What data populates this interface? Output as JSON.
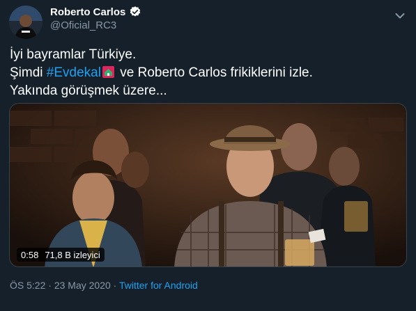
{
  "tweet": {
    "author_name": "Roberto Carlos",
    "author_handle": "@Oficial_RC3",
    "text_line1": "İyi bayramlar Türkiye.",
    "text_line2_prefix": "Şimdi ",
    "hashtag": "#Evdekal",
    "text_line2_suffix": " ve Roberto Carlos frikiklerini izle.",
    "text_line3": "Yakında görüşmek üzere..."
  },
  "video": {
    "duration": "0:58",
    "views": "71,8 B izleyici"
  },
  "meta": {
    "time": "ÖS 5:22",
    "separator": " · ",
    "date": "23 May 2020",
    "source": "Twitter for Android"
  },
  "colors": {
    "background": "#15202b",
    "link": "#1da1f2",
    "secondary_text": "#8899a6",
    "verified_badge": "#ffffff"
  },
  "icons": {
    "verified": "verified-badge-icon",
    "menu": "chevron-down-icon",
    "emoji": "house-emoji-icon"
  }
}
